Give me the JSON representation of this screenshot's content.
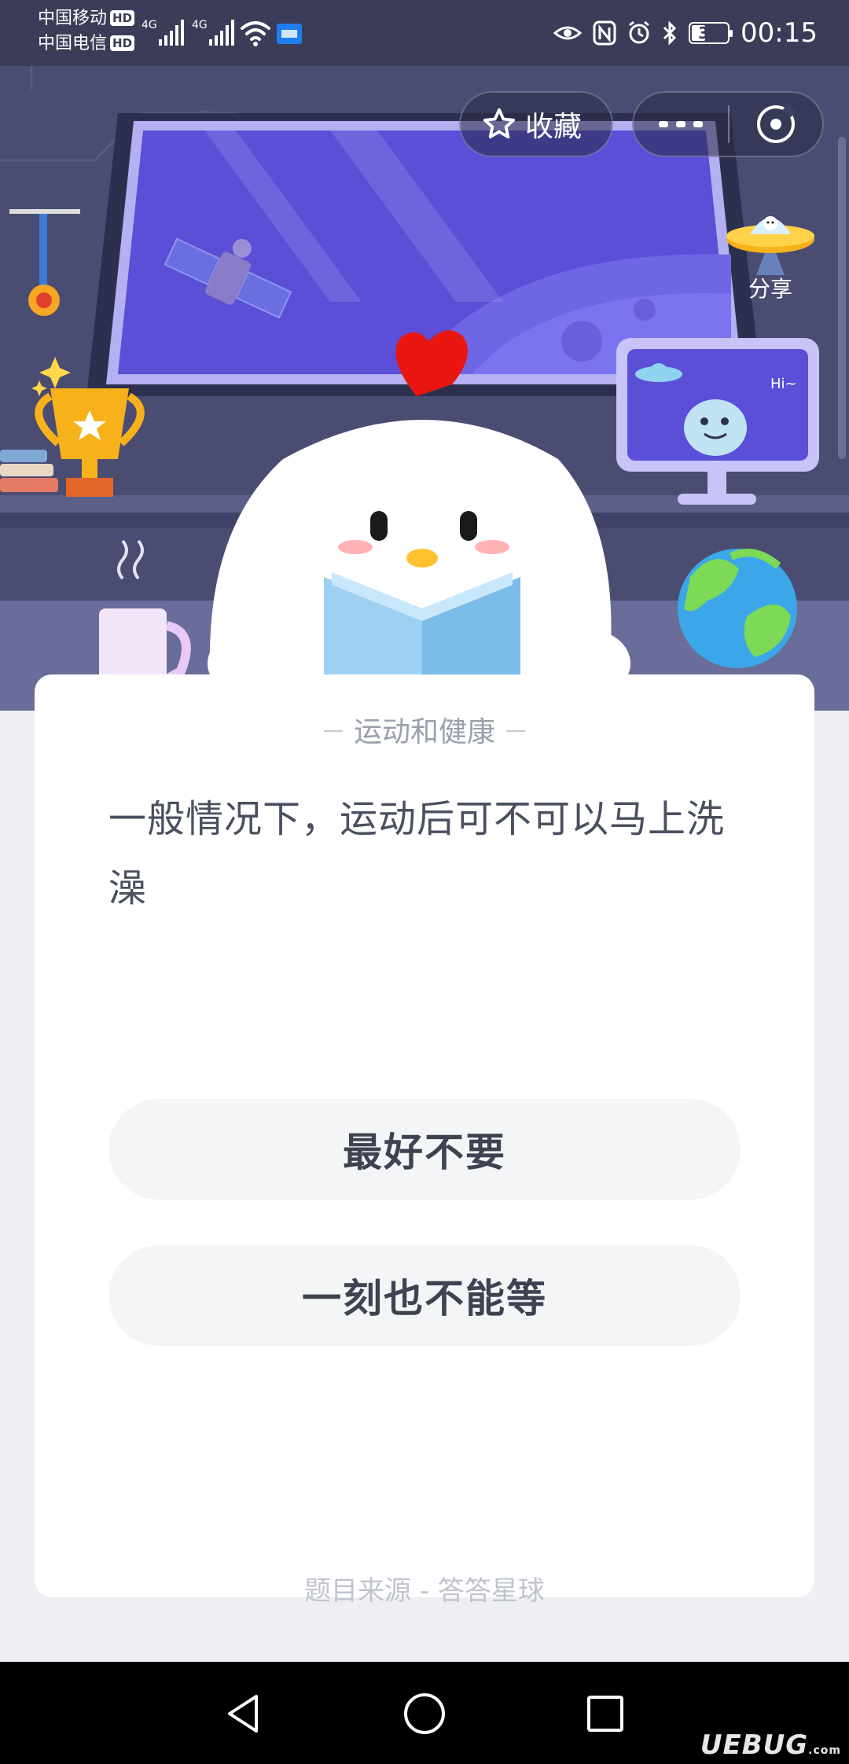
{
  "status_bar": {
    "carrier1": "中国移动",
    "carrier2": "中国电信",
    "hd_badge": "HD",
    "network1": "4G",
    "network2": "4G",
    "battery": "39",
    "battery_level": 0.39,
    "time": "00:15"
  },
  "header": {
    "favorite_label": "收藏",
    "share_label": "分享",
    "hi_text": "Hi~"
  },
  "card": {
    "category": "运动和健康",
    "question": "一般情况下，运动后可不可以马上洗澡",
    "options": [
      "最好不要",
      "一刻也不能等"
    ],
    "source": "题目来源 - 答答星球"
  },
  "watermark": {
    "text": "UEBUG",
    "suffix": ".com"
  },
  "colors": {
    "hero_bg": "#4a4c72",
    "screen_purple": "#5a4fd6",
    "card_bg": "#ffffff",
    "option_bg": "#f4f5f7"
  }
}
